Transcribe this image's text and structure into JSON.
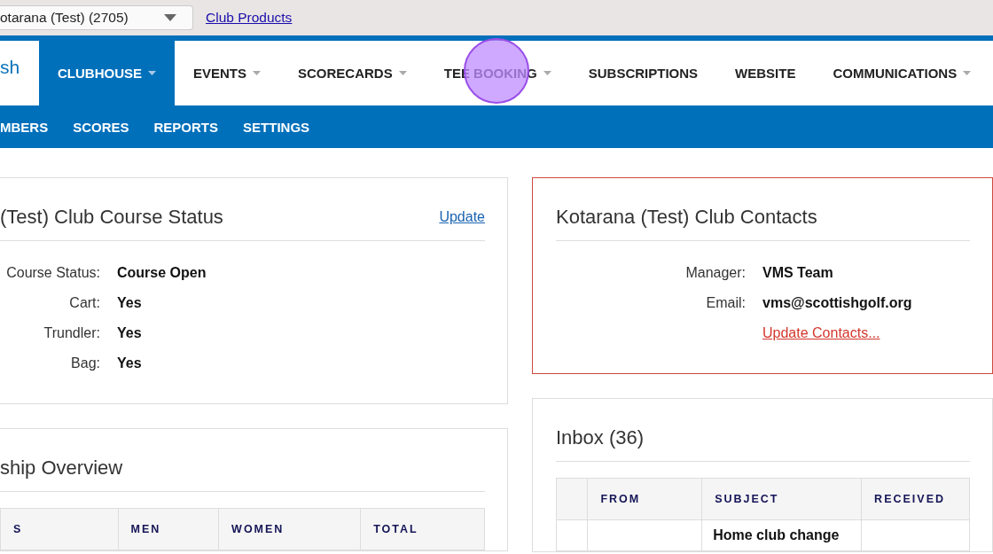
{
  "top_bar": {
    "club_select": {
      "value": "otarana (Test) (2705)"
    },
    "link": "Club Products"
  },
  "logo": {
    "text": "sh"
  },
  "main_nav": [
    {
      "label": "CLUBHOUSE",
      "dropdown": true,
      "selected": true
    },
    {
      "label": "EVENTS",
      "dropdown": true,
      "selected": false
    },
    {
      "label": "SCORECARDS",
      "dropdown": true,
      "selected": false
    },
    {
      "label": "TEE BOOKING",
      "dropdown": true,
      "selected": false
    },
    {
      "label": "SUBSCRIPTIONS",
      "dropdown": false,
      "selected": false
    },
    {
      "label": "WEBSITE",
      "dropdown": false,
      "selected": false
    },
    {
      "label": "COMMUNICATIONS",
      "dropdown": true,
      "selected": false
    }
  ],
  "click_highlight": {
    "on": true
  },
  "sub_nav": [
    "MBERS",
    "SCORES",
    "REPORTS",
    "SETTINGS"
  ],
  "course_status": {
    "title": "(Test) Club Course Status",
    "action": "Update",
    "rows": [
      {
        "label": "Course Status:",
        "value": "Course Open"
      },
      {
        "label": "Cart:",
        "value": "Yes"
      },
      {
        "label": "Trundler:",
        "value": "Yes"
      },
      {
        "label": "Bag:",
        "value": "Yes"
      }
    ]
  },
  "club_contacts": {
    "title": "Kotarana (Test) Club Contacts",
    "rows": [
      {
        "label": "Manager:",
        "value": "VMS Team"
      },
      {
        "label": "Email:",
        "value": "vms@scottishgolf.org"
      }
    ],
    "action": "Update Contacts..."
  },
  "membership_overview": {
    "title": "ship Overview",
    "table": {
      "columns": [
        "S",
        "MEN",
        "WOMEN",
        "TOTAL"
      ]
    }
  },
  "inbox": {
    "title": "Inbox (36)",
    "table": {
      "columns": [
        "",
        "FROM",
        "SUBJECT",
        "RECEIVED"
      ],
      "rows": [
        [
          "",
          "",
          "Home club change",
          ""
        ]
      ]
    }
  }
}
